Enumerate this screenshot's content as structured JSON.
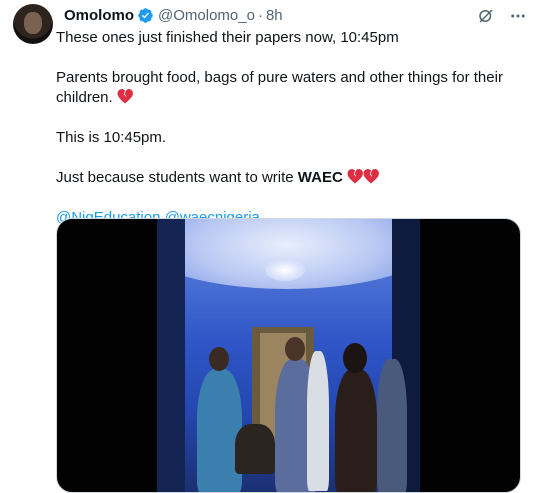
{
  "tweet": {
    "author_name": "Omolomo",
    "author_handle": "@Omolomo_o",
    "separator": "·",
    "timestamp": "8h",
    "lines": {
      "line1": "These ones just finished their papers now, 10:45pm",
      "line2": "Parents brought food, bags of pure waters and other things for their children.",
      "line3": "This is 10:45pm.",
      "line4_prefix": "Just because students want to write ",
      "line4_bold": "WAEC"
    },
    "mentions": [
      "@NigEducation",
      "@waecnigeria"
    ]
  },
  "icons": {
    "verified": "verified-badge-icon",
    "grok": "grok-icon",
    "more": "more-options-icon",
    "broken_heart": "broken-heart-emoji"
  },
  "colors": {
    "accent": "#1d9bf0",
    "secondary_text": "#536471",
    "text": "#0f1419",
    "broken_heart": "#dd2e44"
  }
}
